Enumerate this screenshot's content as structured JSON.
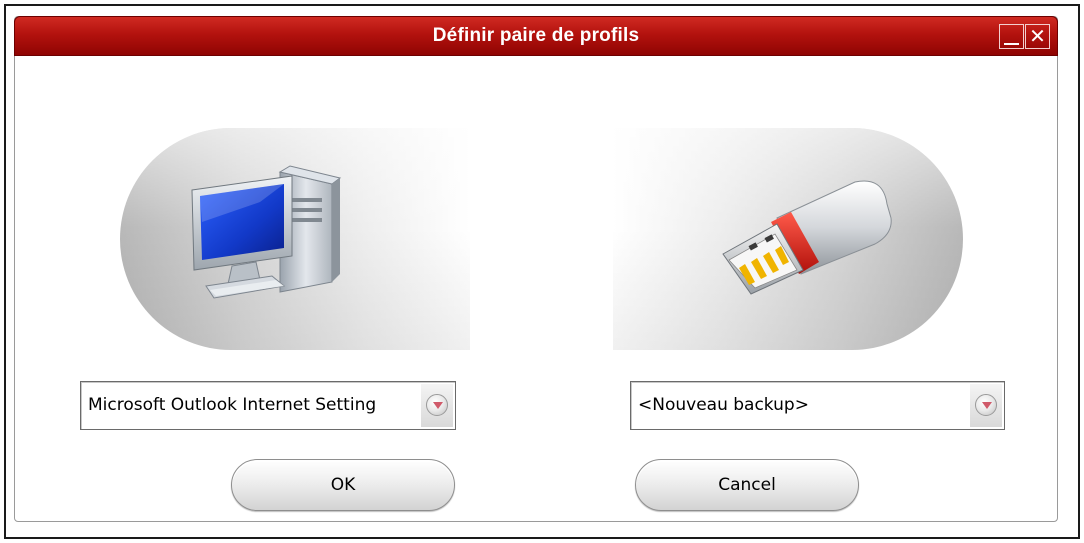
{
  "window": {
    "title": "Définir paire de profils",
    "minimize_glyph": "_",
    "close_glyph": "✕"
  },
  "source": {
    "icon": "desktop-computer-icon",
    "selected_profile": "Microsoft Outlook Internet Setting"
  },
  "destination": {
    "icon": "usb-drive-icon",
    "selected_backup": "<Nouveau backup>"
  },
  "buttons": {
    "ok_label": "OK",
    "cancel_label": "Cancel"
  },
  "colors": {
    "titlebar": "#b3120e",
    "accent_red": "#d22a20",
    "monitor_blue": "#1f4fd8"
  }
}
